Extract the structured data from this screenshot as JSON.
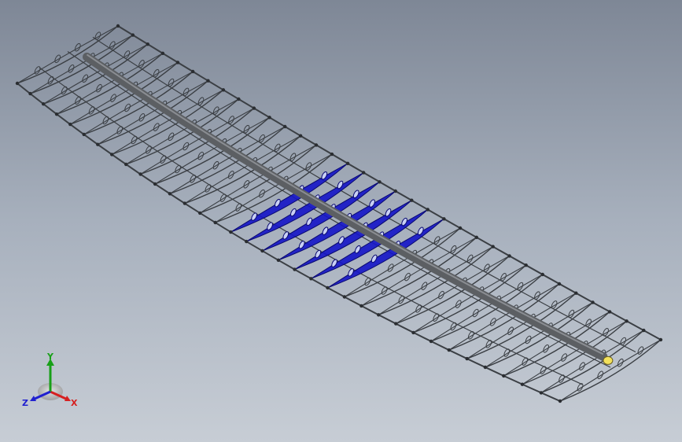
{
  "viewport": {
    "background_top": "#7e8796",
    "background_bottom": "#c7cdd5"
  },
  "model": {
    "name": "wing-structure-ribs-and-spar",
    "frame_color": "#3b3f44",
    "spar_color": "#5c5f63",
    "selected_color": "#1414c8",
    "end_cap_color": "#f3e15c"
  },
  "triad": {
    "x_label": "X",
    "y_label": "Y",
    "z_label": "Z",
    "x_color": "#d62020",
    "y_color": "#18a018",
    "z_color": "#2020d0"
  }
}
